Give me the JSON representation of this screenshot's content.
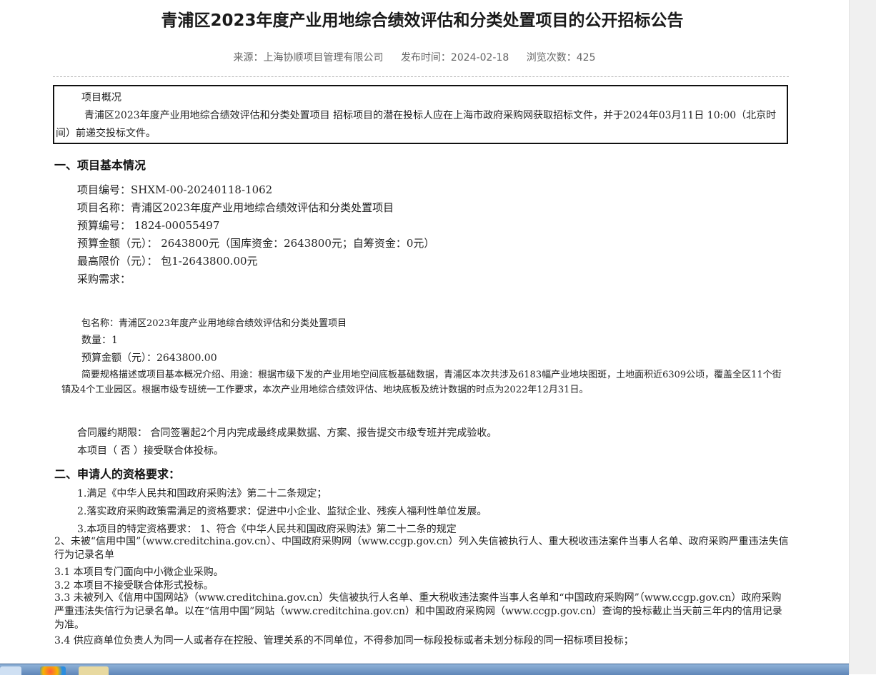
{
  "header": {
    "title": "青浦区2023年度产业用地综合绩效评估和分类处置项目的公开招标公告",
    "source": "来源：上海协顺项目管理有限公司",
    "publish_time": "发布时间：2024-02-18",
    "views": "浏览次数：425"
  },
  "overview": {
    "heading": "项目概况",
    "body": "青浦区2023年度产业用地综合绩效评估和分类处置项目 招标项目的潜在投标人应在上海市政府采购网获取招标文件，并于2024年03月11日 10:00（北京时间）前递交投标文件。"
  },
  "section1": {
    "heading": "一、项目基本情况",
    "project_no": "项目编号：SHXM-00-20240118-1062",
    "project_name": "项目名称：青浦区2023年度产业用地综合绩效评估和分类处置项目",
    "budget_no": "预算编号： 1824-00055497",
    "budget_amount": "预算金额（元）： 2643800元（国库资金：2643800元；自筹资金：0元）",
    "max_price": "最高限价（元）： 包1-2643800.00元",
    "requirement": "采购需求：",
    "package_name": "包名称：青浦区2023年度产业用地综合绩效评估和分类处置项目",
    "quantity": "数量：1",
    "package_budget": "预算金额（元）：2643800.00",
    "description": "简要规格描述或项目基本概况介绍、用途：根据市级下发的产业用地空间底板基础数据，青浦区本次共涉及6183幅产业地块图斑，土地面积近6309公顷，覆盖全区11个街镇及4个工业园区。根据市级专班统一工作要求，本次产业用地综合绩效评估、地块底板及统计数据的时点为2022年12月31日。",
    "contract_period": "合同履约期限： 合同签署起2个月内完成最终成果数据、方案、报告提交市级专班并完成验收。",
    "joint_bid": "本项目（ 否 ）接受联合体投标。"
  },
  "section2": {
    "heading": "二、申请人的资格要求：",
    "item1": "1.满足《中华人民共和国政府采购法》第二十二条规定；",
    "item2": "2.落实政府采购政策需满足的资格要求：促进中小企业、监狱企业、残疾人福利性单位发展。",
    "item3": "3.本项目的特定资格要求： 1、符合《中华人民共和国政府采购法》第二十二条的规定",
    "item4": "2、未被“信用中国”（www.creditchina.gov.cn）、中国政府采购网（www.ccgp.gov.cn）列入失信被执行人、重大税收违法案件当事人名单、政府采购严重违法失信行为记录名单",
    "item5": "3.1 本项目专门面向中小微企业采购。",
    "item6": "3.2 本项目不接受联合体形式投标。",
    "item7": "3.3 未被列入《信用中国网站》（www.creditchina.gov.cn）失信被执行人名单、重大税收违法案件当事人名单和“中国政府采购网”（www.ccgp.gov.cn）政府采购严重违法失信行为记录名单。以在“信用中国”网站（www.creditchina.gov.cn）和中国政府采购网（www.ccgp.gov.cn）查询的投标截止当天前三年内的信用记录为准。",
    "item8": "3.4 供应商单位负责人为同一人或者存在控股、管理关系的不同单位，不得参加同一标段投标或者未划分标段的同一招标项目投标；"
  }
}
